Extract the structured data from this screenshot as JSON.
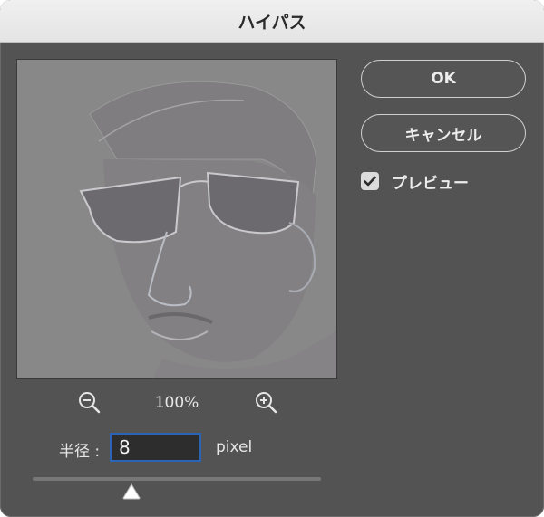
{
  "dialog": {
    "title": "ハイパス",
    "ok_label": "OK",
    "cancel_label": "キャンセル",
    "preview_label": "プレビュー",
    "preview_checked": true
  },
  "zoom": {
    "level": "100%",
    "zoom_out_icon": "zoom-out-magnifier",
    "zoom_in_icon": "zoom-in-magnifier"
  },
  "radius": {
    "label": "半径 :",
    "value": "8",
    "unit": "pixel"
  },
  "slider": {
    "value_fraction": 0.34
  },
  "colors": {
    "dialog_bg": "#535353",
    "titlebar_bg": "#e6e6e6",
    "input_focus_border": "#2a64b7",
    "preview_gray": "#898888"
  }
}
